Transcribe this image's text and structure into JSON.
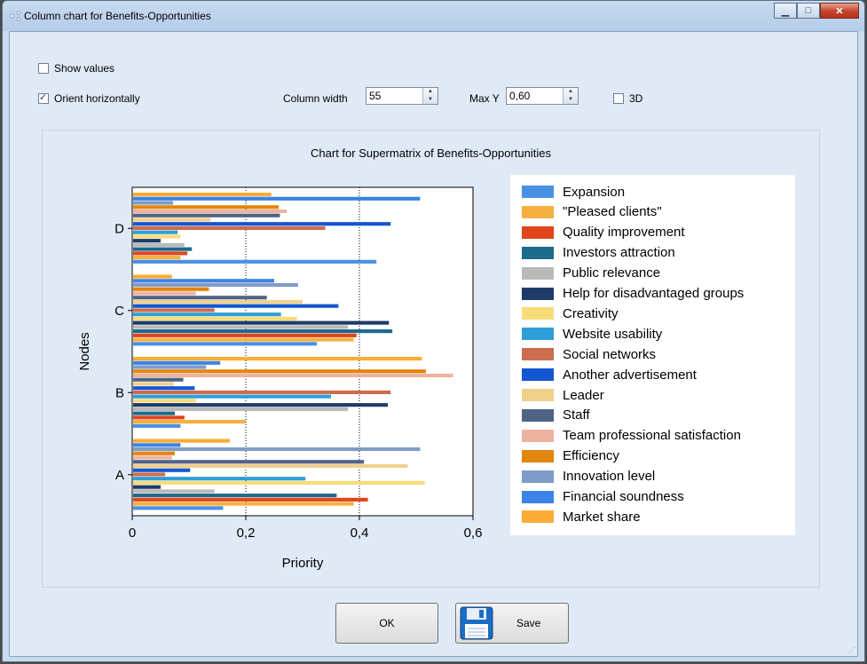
{
  "window": {
    "title": "Column chart for Benefits-Opportunities"
  },
  "controls": {
    "show_values": {
      "label": "Show values",
      "checked": false
    },
    "orient_horizontally": {
      "label": "Orient horizontally",
      "checked": true
    },
    "column_width": {
      "label": "Column width",
      "value": "55"
    },
    "max_y": {
      "label": "Max Y",
      "value": "0,60"
    },
    "three_d": {
      "label": "3D",
      "checked": false
    }
  },
  "buttons": {
    "ok": "OK",
    "save": "Save"
  },
  "chart_data": {
    "type": "bar",
    "orientation": "horizontal",
    "title": "Chart for Supermatrix of Benefits-Opportunities",
    "xlabel": "Priority",
    "ylabel": "Nodes",
    "xlim": [
      0,
      0.6
    ],
    "x_ticks": [
      "0",
      "0,2",
      "0,4",
      "0,6"
    ],
    "gridlines": [
      0.2,
      0.4
    ],
    "legend_position": "right",
    "categories": [
      "A",
      "B",
      "C",
      "D"
    ],
    "series": [
      {
        "name": "Expansion",
        "color": "#4a90e2",
        "values": [
          0.16,
          0.085,
          0.325,
          0.43
        ]
      },
      {
        "name": "\"Pleased clients\"",
        "color": "#f5b041",
        "values": [
          0.39,
          0.2,
          0.39,
          0.085
        ]
      },
      {
        "name": "Quality improvement",
        "color": "#e0451b",
        "values": [
          0.415,
          0.092,
          0.395,
          0.097
        ]
      },
      {
        "name": "Investors attraction",
        "color": "#1c6a8c",
        "values": [
          0.36,
          0.075,
          0.458,
          0.105
        ]
      },
      {
        "name": "Public relevance",
        "color": "#b9b9b9",
        "values": [
          0.145,
          0.38,
          0.38,
          0.092
        ]
      },
      {
        "name": "Help for disadvantaged groups",
        "color": "#1f3b68",
        "values": [
          0.05,
          0.45,
          0.452,
          0.05
        ]
      },
      {
        "name": "Creativity",
        "color": "#f7dc7a",
        "values": [
          0.515,
          0.112,
          0.29,
          0.085
        ]
      },
      {
        "name": "Website usability",
        "color": "#2e9fd6",
        "values": [
          0.305,
          0.35,
          0.262,
          0.08
        ]
      },
      {
        "name": "Social networks",
        "color": "#cc6d50",
        "values": [
          0.058,
          0.455,
          0.145,
          0.34
        ]
      },
      {
        "name": "Another advertisement",
        "color": "#1257d0",
        "values": [
          0.102,
          0.11,
          0.363,
          0.455
        ]
      },
      {
        "name": "Leader",
        "color": "#f1d08e",
        "values": [
          0.485,
          0.073,
          0.3,
          0.138
        ]
      },
      {
        "name": "Staff",
        "color": "#4f6384",
        "values": [
          0.408,
          0.09,
          0.237,
          0.26
        ]
      },
      {
        "name": "Team professional satisfaction",
        "color": "#eeb2a0",
        "values": [
          0.07,
          0.565,
          0.112,
          0.272
        ]
      },
      {
        "name": "Efficiency",
        "color": "#e2860d",
        "values": [
          0.075,
          0.517,
          0.135,
          0.258
        ]
      },
      {
        "name": "Innovation level",
        "color": "#7f9cc9",
        "values": [
          0.507,
          0.13,
          0.292,
          0.072
        ]
      },
      {
        "name": "Financial soundness",
        "color": "#3b83e6",
        "values": [
          0.085,
          0.155,
          0.25,
          0.507
        ]
      },
      {
        "name": "Market share",
        "color": "#fbac36",
        "values": [
          0.172,
          0.51,
          0.07,
          0.245
        ]
      }
    ]
  }
}
